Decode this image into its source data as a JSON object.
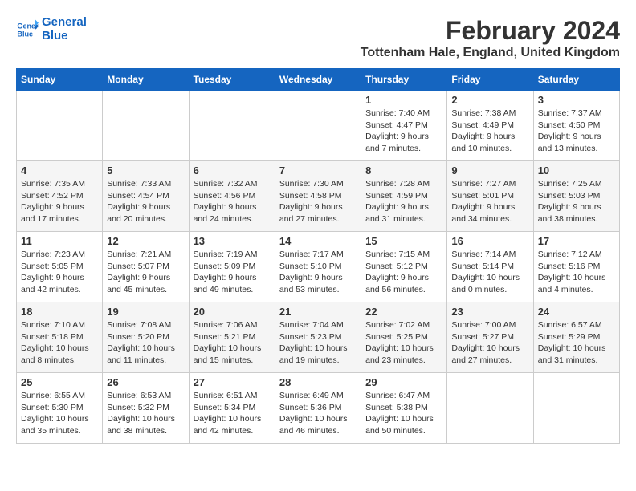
{
  "header": {
    "logo_line1": "General",
    "logo_line2": "Blue",
    "main_title": "February 2024",
    "subtitle": "Tottenham Hale, England, United Kingdom"
  },
  "weekdays": [
    "Sunday",
    "Monday",
    "Tuesday",
    "Wednesday",
    "Thursday",
    "Friday",
    "Saturday"
  ],
  "weeks": [
    [
      {
        "day": "",
        "info": ""
      },
      {
        "day": "",
        "info": ""
      },
      {
        "day": "",
        "info": ""
      },
      {
        "day": "",
        "info": ""
      },
      {
        "day": "1",
        "info": "Sunrise: 7:40 AM\nSunset: 4:47 PM\nDaylight: 9 hours\nand 7 minutes."
      },
      {
        "day": "2",
        "info": "Sunrise: 7:38 AM\nSunset: 4:49 PM\nDaylight: 9 hours\nand 10 minutes."
      },
      {
        "day": "3",
        "info": "Sunrise: 7:37 AM\nSunset: 4:50 PM\nDaylight: 9 hours\nand 13 minutes."
      }
    ],
    [
      {
        "day": "4",
        "info": "Sunrise: 7:35 AM\nSunset: 4:52 PM\nDaylight: 9 hours\nand 17 minutes."
      },
      {
        "day": "5",
        "info": "Sunrise: 7:33 AM\nSunset: 4:54 PM\nDaylight: 9 hours\nand 20 minutes."
      },
      {
        "day": "6",
        "info": "Sunrise: 7:32 AM\nSunset: 4:56 PM\nDaylight: 9 hours\nand 24 minutes."
      },
      {
        "day": "7",
        "info": "Sunrise: 7:30 AM\nSunset: 4:58 PM\nDaylight: 9 hours\nand 27 minutes."
      },
      {
        "day": "8",
        "info": "Sunrise: 7:28 AM\nSunset: 4:59 PM\nDaylight: 9 hours\nand 31 minutes."
      },
      {
        "day": "9",
        "info": "Sunrise: 7:27 AM\nSunset: 5:01 PM\nDaylight: 9 hours\nand 34 minutes."
      },
      {
        "day": "10",
        "info": "Sunrise: 7:25 AM\nSunset: 5:03 PM\nDaylight: 9 hours\nand 38 minutes."
      }
    ],
    [
      {
        "day": "11",
        "info": "Sunrise: 7:23 AM\nSunset: 5:05 PM\nDaylight: 9 hours\nand 42 minutes."
      },
      {
        "day": "12",
        "info": "Sunrise: 7:21 AM\nSunset: 5:07 PM\nDaylight: 9 hours\nand 45 minutes."
      },
      {
        "day": "13",
        "info": "Sunrise: 7:19 AM\nSunset: 5:09 PM\nDaylight: 9 hours\nand 49 minutes."
      },
      {
        "day": "14",
        "info": "Sunrise: 7:17 AM\nSunset: 5:10 PM\nDaylight: 9 hours\nand 53 minutes."
      },
      {
        "day": "15",
        "info": "Sunrise: 7:15 AM\nSunset: 5:12 PM\nDaylight: 9 hours\nand 56 minutes."
      },
      {
        "day": "16",
        "info": "Sunrise: 7:14 AM\nSunset: 5:14 PM\nDaylight: 10 hours\nand 0 minutes."
      },
      {
        "day": "17",
        "info": "Sunrise: 7:12 AM\nSunset: 5:16 PM\nDaylight: 10 hours\nand 4 minutes."
      }
    ],
    [
      {
        "day": "18",
        "info": "Sunrise: 7:10 AM\nSunset: 5:18 PM\nDaylight: 10 hours\nand 8 minutes."
      },
      {
        "day": "19",
        "info": "Sunrise: 7:08 AM\nSunset: 5:20 PM\nDaylight: 10 hours\nand 11 minutes."
      },
      {
        "day": "20",
        "info": "Sunrise: 7:06 AM\nSunset: 5:21 PM\nDaylight: 10 hours\nand 15 minutes."
      },
      {
        "day": "21",
        "info": "Sunrise: 7:04 AM\nSunset: 5:23 PM\nDaylight: 10 hours\nand 19 minutes."
      },
      {
        "day": "22",
        "info": "Sunrise: 7:02 AM\nSunset: 5:25 PM\nDaylight: 10 hours\nand 23 minutes."
      },
      {
        "day": "23",
        "info": "Sunrise: 7:00 AM\nSunset: 5:27 PM\nDaylight: 10 hours\nand 27 minutes."
      },
      {
        "day": "24",
        "info": "Sunrise: 6:57 AM\nSunset: 5:29 PM\nDaylight: 10 hours\nand 31 minutes."
      }
    ],
    [
      {
        "day": "25",
        "info": "Sunrise: 6:55 AM\nSunset: 5:30 PM\nDaylight: 10 hours\nand 35 minutes."
      },
      {
        "day": "26",
        "info": "Sunrise: 6:53 AM\nSunset: 5:32 PM\nDaylight: 10 hours\nand 38 minutes."
      },
      {
        "day": "27",
        "info": "Sunrise: 6:51 AM\nSunset: 5:34 PM\nDaylight: 10 hours\nand 42 minutes."
      },
      {
        "day": "28",
        "info": "Sunrise: 6:49 AM\nSunset: 5:36 PM\nDaylight: 10 hours\nand 46 minutes."
      },
      {
        "day": "29",
        "info": "Sunrise: 6:47 AM\nSunset: 5:38 PM\nDaylight: 10 hours\nand 50 minutes."
      },
      {
        "day": "",
        "info": ""
      },
      {
        "day": "",
        "info": ""
      }
    ]
  ]
}
